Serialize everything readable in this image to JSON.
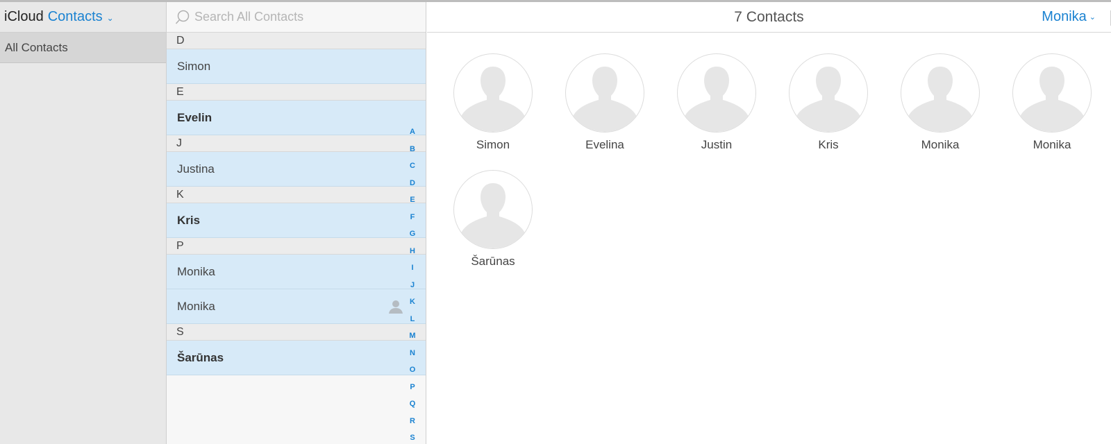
{
  "app": {
    "brand": "iCloud",
    "name": "Contacts"
  },
  "sidebar": {
    "group": "All Contacts"
  },
  "search": {
    "placeholder": "Search All Contacts"
  },
  "list": {
    "sections": [
      {
        "letter": "D",
        "contacts": [
          {
            "name": "Simon",
            "bold": false
          }
        ]
      },
      {
        "letter": "E",
        "contacts": [
          {
            "name": "Evelin",
            "bold": true
          }
        ]
      },
      {
        "letter": "J",
        "contacts": [
          {
            "name": "Justina",
            "bold": false
          }
        ]
      },
      {
        "letter": "K",
        "contacts": [
          {
            "name": "Kris",
            "bold": true
          }
        ]
      },
      {
        "letter": "P",
        "contacts": [
          {
            "name": "Monika",
            "bold": false
          },
          {
            "name": "Monika",
            "bold": false,
            "me": true
          }
        ]
      },
      {
        "letter": "S",
        "contacts": [
          {
            "name": "Šarūnas",
            "bold": true
          }
        ]
      }
    ],
    "index": [
      "A",
      "B",
      "C",
      "D",
      "E",
      "F",
      "G",
      "H",
      "I",
      "J",
      "K",
      "L",
      "M",
      "N",
      "O",
      "P",
      "Q",
      "R",
      "S"
    ]
  },
  "main": {
    "count": "7 Contacts",
    "user": "Monika",
    "cards": [
      "Simon",
      "Evelina",
      "Justin",
      "Kris",
      "Monika",
      "Monika",
      "Šarūnas"
    ]
  },
  "colors": {
    "accent": "#1a82d1",
    "selected_row": "#d7eaf8",
    "sidebar": "#e8e8e8"
  },
  "icons": {
    "search": "search-icon",
    "avatar": "person-silhouette-icon",
    "chevron": "chevron-down-icon",
    "me": "person-icon"
  }
}
